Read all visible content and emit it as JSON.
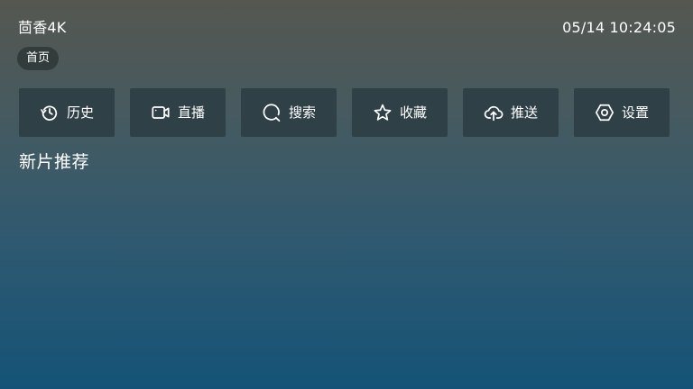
{
  "app": {
    "title": "茴香4K"
  },
  "status": {
    "datetime": "05/14 10:24:05"
  },
  "nav": {
    "home_chip": "首页"
  },
  "toolbar": {
    "items": [
      {
        "label": "历史",
        "icon": "history-icon"
      },
      {
        "label": "直播",
        "icon": "video-camera-icon"
      },
      {
        "label": "搜索",
        "icon": "search-icon"
      },
      {
        "label": "收藏",
        "icon": "star-icon"
      },
      {
        "label": "推送",
        "icon": "cloud-upload-icon"
      },
      {
        "label": "设置",
        "icon": "hexagon-settings-icon"
      }
    ]
  },
  "sections": {
    "new_releases_title": "新片推荐"
  },
  "colors": {
    "background_top": "#555750",
    "background_bottom": "#145377",
    "button_bg": "#2f4047",
    "chip_bg": "#333c3c",
    "text": "#ffffff"
  }
}
